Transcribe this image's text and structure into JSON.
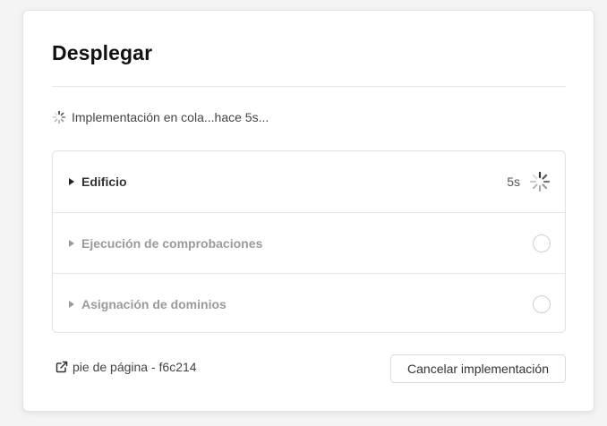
{
  "dialog": {
    "title": "Desplegar",
    "status_text": "Implementación en cola...hace 5s..."
  },
  "steps": [
    {
      "label": "Edificio",
      "state": "running",
      "elapsed": "5s"
    },
    {
      "label": "Ejecución de comprobaciones",
      "state": "pending"
    },
    {
      "label": "Asignación de dominios",
      "state": "pending"
    }
  ],
  "footer": {
    "link_text": "pie de página - f6c214",
    "cancel_label": "Cancelar implementación"
  },
  "icons": {
    "status": "spinner-icon",
    "step_toggle": "caret-right-icon",
    "running": "spinner-icon",
    "pending": "empty-circle-icon",
    "link": "external-link-icon"
  },
  "colors": {
    "active_text": "#333333",
    "pending_text": "#9a9a9a",
    "border": "#e3e3e3"
  }
}
